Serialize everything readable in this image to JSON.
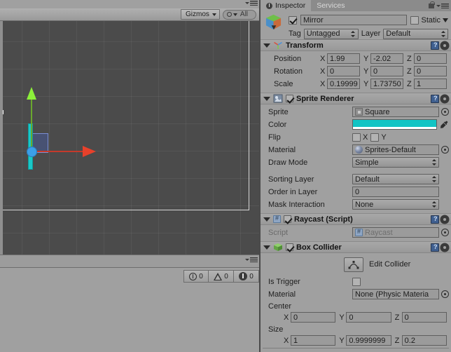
{
  "scene_view": {
    "toolbar": {
      "gizmos_label": "Gizmos",
      "search_value": "All",
      "search_placeholder": "All"
    },
    "status": {
      "info_count": "0",
      "warning_count": "0",
      "error_count": "0"
    }
  },
  "inspector": {
    "tabs": [
      {
        "label": "Inspector",
        "active": true
      },
      {
        "label": "Services",
        "active": false
      }
    ],
    "object": {
      "name": "Mirror",
      "enabled": true,
      "static_label": "Static",
      "static_checked": false,
      "tag_label": "Tag",
      "tag_value": "Untagged",
      "layer_label": "Layer",
      "layer_value": "Default"
    },
    "components": [
      {
        "title": "Transform",
        "rows": {
          "position_label": "Position",
          "position": {
            "x": "1.99",
            "y": "-2.02",
            "z": "0"
          },
          "rotation_label": "Rotation",
          "rotation": {
            "x": "0",
            "y": "0",
            "z": "0"
          },
          "scale_label": "Scale",
          "scale": {
            "x": "0.19999",
            "y": "1.73750",
            "z": "1"
          }
        }
      },
      {
        "title": "Sprite Renderer",
        "enabled": true,
        "rows": {
          "sprite_label": "Sprite",
          "sprite_value": "Square",
          "color_label": "Color",
          "color_value": "#12C4C4",
          "flip_label": "Flip",
          "flip_x_label": "X",
          "flip_y_label": "Y",
          "flip_x_checked": false,
          "flip_y_checked": false,
          "material_label": "Material",
          "material_value": "Sprites-Default",
          "draw_mode_label": "Draw Mode",
          "draw_mode_value": "Simple",
          "sorting_layer_label": "Sorting Layer",
          "sorting_layer_value": "Default",
          "order_in_layer_label": "Order in Layer",
          "order_in_layer_value": "0",
          "mask_interaction_label": "Mask Interaction",
          "mask_interaction_value": "None"
        }
      },
      {
        "title": "Raycast (Script)",
        "enabled": true,
        "rows": {
          "script_label": "Script",
          "script_value": "Raycast"
        }
      },
      {
        "title": "Box Collider",
        "enabled": true,
        "rows": {
          "edit_collider_label": "Edit Collider",
          "is_trigger_label": "Is Trigger",
          "is_trigger_checked": false,
          "material_label": "Material",
          "material_value": "None (Physic Materia",
          "center_label": "Center",
          "center": {
            "x": "0",
            "y": "0",
            "z": "0"
          },
          "size_label": "Size",
          "size": {
            "x": "1",
            "y": "0.9999999",
            "z": "0.2"
          }
        }
      }
    ]
  },
  "axis_labels": {
    "x": "X",
    "y": "Y",
    "z": "Z"
  },
  "colors": {
    "sprite_color": "#12C4C4",
    "gizmo_x": "#E8412B",
    "gizmo_y": "#8CF03A",
    "gizmo_center": "#3C9FE8",
    "panel_bg": "#A0A0A0",
    "scene_bg": "#4B4B4B"
  }
}
